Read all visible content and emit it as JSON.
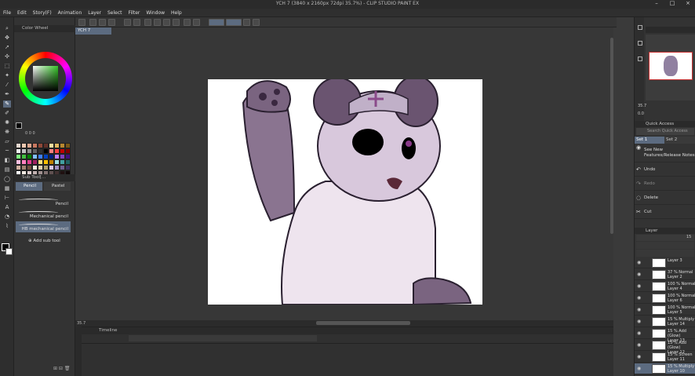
{
  "window": {
    "title": "YCH 7 (3840 x 2160px 72dpi 35.7%)  - CLIP STUDIO PAINT EX"
  },
  "menu": [
    "File",
    "Edit",
    "Story(F)",
    "Animation",
    "Layer",
    "Select",
    "Filter",
    "Window",
    "Help"
  ],
  "left_panel": {
    "color_wheel_title": "Color Wheel",
    "color_values": "0  0  0",
    "subtool_title": "Sub Tool[...",
    "subtool_tabs": [
      "Pencil",
      "Pastel"
    ],
    "subtools": [
      "Pencil",
      "Mechanical pencil",
      "HB mechanical pencil"
    ],
    "add_subtool": "Add sub tool",
    "palette": [
      "#e8d8d0",
      "#f0c8b0",
      "#e0a890",
      "#c87860",
      "#904838",
      "#603028",
      "#f8e0a0",
      "#e0b860",
      "#b88830",
      "#785818",
      "#f0f0f0",
      "#c0c0c0",
      "#909090",
      "#606060",
      "#303030",
      "#000000",
      "#ff8080",
      "#ff4040",
      "#c00000",
      "#800000",
      "#80ff80",
      "#40c040",
      "#008000",
      "#80c0ff",
      "#4080ff",
      "#0040c0",
      "#002080",
      "#c080ff",
      "#8040c0",
      "#401080",
      "#ffc0e0",
      "#ff80c0",
      "#e04090",
      "#a02060",
      "#ffe080",
      "#ffc000",
      "#c08000",
      "#a0e0e0",
      "#40a0a0",
      "#206060",
      "#d0b0a0",
      "#a08070",
      "#705040",
      "#f8f0e0",
      "#e0d0b0",
      "#b0a070",
      "#d8c8e8",
      "#a090c0",
      "#706090",
      "#403060",
      "#ffffff",
      "#f0e8e0",
      "#e0d0d0",
      "#c0b0b0",
      "#a09090",
      "#807070",
      "#605050",
      "#403030",
      "#201010",
      "#100808"
    ]
  },
  "document": {
    "tab": "YCH 7",
    "zoom": "35.7"
  },
  "timeline": {
    "title": "Timeline"
  },
  "right_panel": {
    "navigator_zoom": "35.7",
    "navigator_angle": "0.0",
    "quick_access_title": "Quick Access",
    "quick_access_search": "Search Quick Access",
    "sets": [
      "Set 1",
      "Set 2"
    ],
    "actions": [
      "See New Features/Release Notes",
      "Undo",
      "Redo",
      "Delete",
      "Cut"
    ],
    "layer_title": "Layer",
    "layer_opacity": "15",
    "layers": [
      {
        "mode": "",
        "name": "Layer 3",
        "selected": false
      },
      {
        "mode": "37 % Normal",
        "name": "Layer 2",
        "selected": false
      },
      {
        "mode": "100 % Normal",
        "name": "Layer 4",
        "selected": false
      },
      {
        "mode": "100 % Normal",
        "name": "Layer 6",
        "selected": false
      },
      {
        "mode": "100 % Normal",
        "name": "Layer 5",
        "selected": false
      },
      {
        "mode": "15 % Multiply",
        "name": "Layer 14",
        "selected": false
      },
      {
        "mode": "15 % Add (Glow)",
        "name": "Layer 13",
        "selected": false
      },
      {
        "mode": "15 % Add (Glow)",
        "name": "Layer 12",
        "selected": false
      },
      {
        "mode": "15 % Screen",
        "name": "Layer 11",
        "selected": false
      },
      {
        "mode": "15 % Multiply",
        "name": "Layer 10",
        "selected": true
      }
    ]
  }
}
